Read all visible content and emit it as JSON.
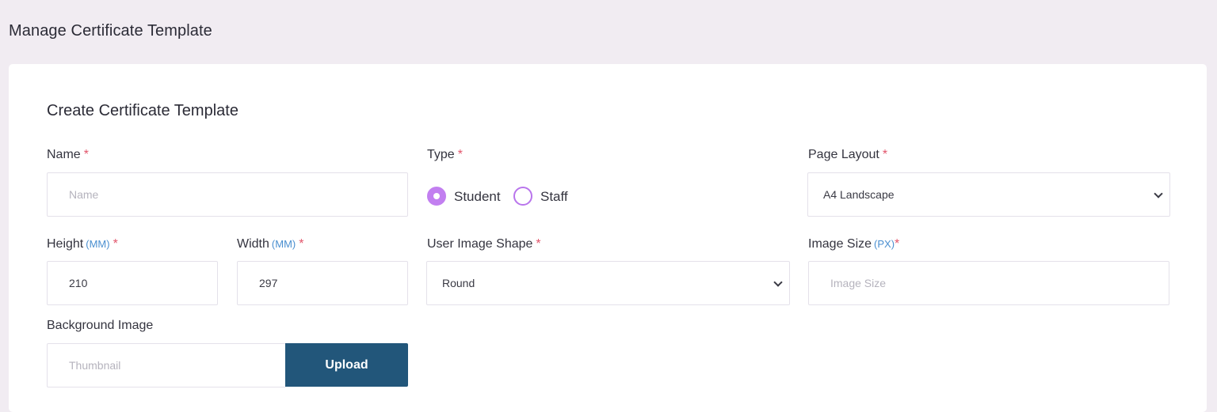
{
  "page": {
    "title": "Manage Certificate Template"
  },
  "form": {
    "title": "Create Certificate Template",
    "required_mark": "*",
    "name": {
      "label": "Name",
      "placeholder": "Name"
    },
    "type": {
      "label": "Type",
      "options": [
        {
          "label": "Student",
          "checked": true
        },
        {
          "label": "Staff",
          "checked": false
        }
      ]
    },
    "page_layout": {
      "label": "Page Layout",
      "value": "A4 Landscape"
    },
    "height": {
      "label": "Height",
      "unit": "(MM)",
      "value": "210"
    },
    "width": {
      "label": "Width",
      "unit": "(MM)",
      "value": "297"
    },
    "user_image_shape": {
      "label": "User Image Shape",
      "value": "Round"
    },
    "image_size": {
      "label": "Image Size",
      "unit": "(PX)",
      "placeholder": "Image Size"
    },
    "background_image": {
      "label": "Background Image",
      "placeholder": "Thumbnail",
      "button": "Upload"
    }
  },
  "colors": {
    "accent_radio": "#c27ff0",
    "upload_button": "#22567a",
    "required": "#e2556b",
    "unit": "#4a8fd0"
  }
}
